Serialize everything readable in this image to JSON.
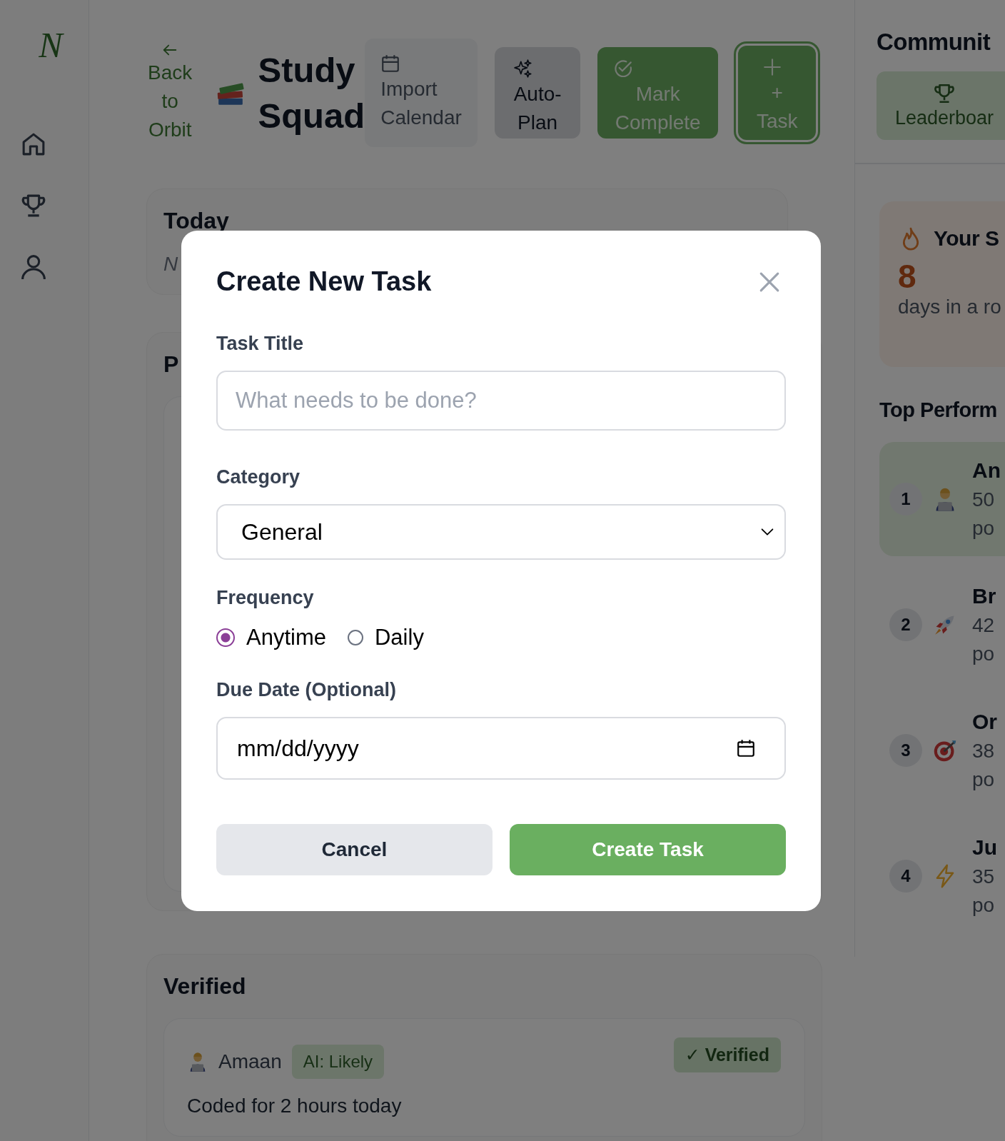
{
  "sidebar": {
    "logo": "N"
  },
  "header": {
    "back_label": "Back to Orbit",
    "title": "Study Squad",
    "buttons": [
      {
        "label": "Import Calendar",
        "kind": "light"
      },
      {
        "label": "Auto-Plan",
        "kind": "grey"
      },
      {
        "label": "Mark Complete",
        "kind": "green"
      },
      {
        "label": "+ Task",
        "kind": "ring"
      }
    ]
  },
  "today": {
    "title": "Today",
    "note": "N"
  },
  "pending": {
    "title": "P"
  },
  "verified": {
    "title": "Verified",
    "entries": [
      {
        "name": "Amaan",
        "tag": "AI: Likely",
        "status": "✓ Verified",
        "text": "Coded for 2 hours today"
      }
    ]
  },
  "community": {
    "title": "Communit",
    "leaderboard_button": "Leaderboar",
    "streak": {
      "title": "Your S",
      "count": "8",
      "caption": "days in a ro"
    },
    "top_title": "Top Perform",
    "performers": [
      {
        "rank": "1",
        "name": "An",
        "points": "50",
        "unit": "po",
        "selected": true
      },
      {
        "rank": "2",
        "name": "Br",
        "points": "42",
        "unit": "po",
        "selected": false
      },
      {
        "rank": "3",
        "name": "Or",
        "points": "38",
        "unit": "po",
        "selected": false
      },
      {
        "rank": "4",
        "name": "Ju",
        "points": "35",
        "unit": "po",
        "selected": false
      }
    ]
  },
  "modal": {
    "title": "Create New Task",
    "task_title": {
      "label": "Task Title",
      "placeholder": "What needs to be done?"
    },
    "category": {
      "label": "Category",
      "value": "General"
    },
    "frequency": {
      "label": "Frequency",
      "options": [
        {
          "label": "Anytime",
          "selected": true
        },
        {
          "label": "Daily",
          "selected": false
        }
      ]
    },
    "due_date": {
      "label": "Due Date (Optional)",
      "value": "mm/dd/yyyy"
    },
    "buttons": [
      {
        "label": "Cancel",
        "kind": "cancel"
      },
      {
        "label": "Create Task",
        "kind": "submit"
      }
    ]
  }
}
